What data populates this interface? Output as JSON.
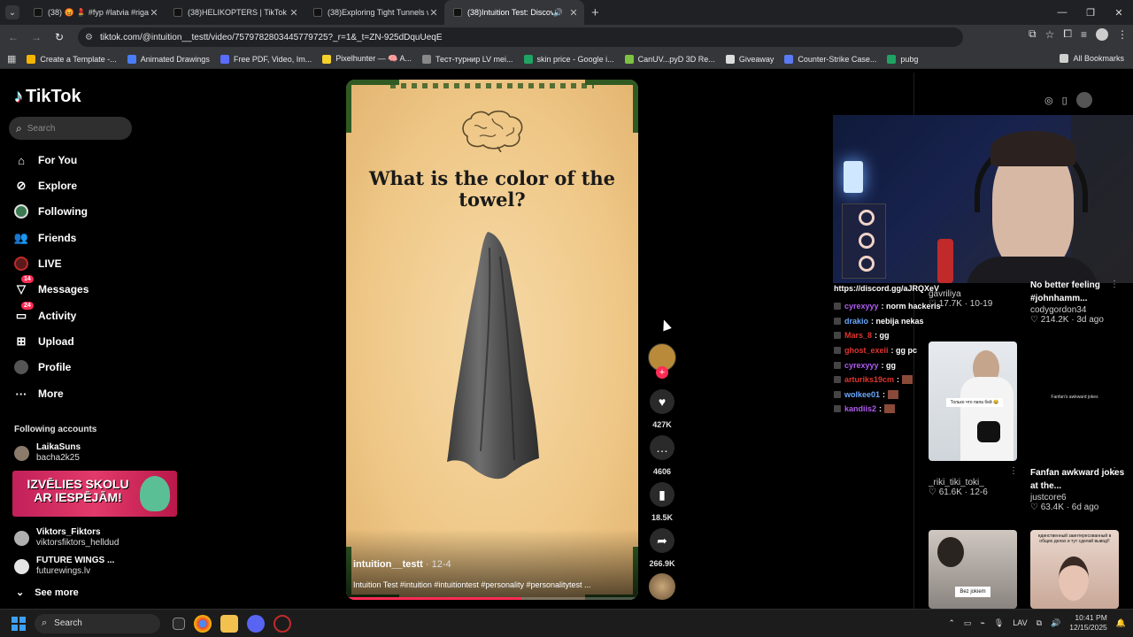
{
  "browser": {
    "tabs": [
      {
        "title": "(38) 😡 💄 #fyp #latvia #riga #i",
        "active": false
      },
      {
        "title": "(38)HELIKOPTERS | TikTok",
        "active": false
      },
      {
        "title": "(38)Exploring Tight Tunnels wit",
        "active": false
      },
      {
        "title": "(38)Intuition Test: Discover",
        "active": true
      }
    ],
    "url": "tiktok.com/@intuition__testt/video/7579782803445779725?_r=1&_t=ZN-925dDquUeqE",
    "bookmarks": [
      {
        "label": "Create a Template -...",
        "color": "#f4b400"
      },
      {
        "label": "Animated Drawings",
        "color": "#4a7df5"
      },
      {
        "label": "Free PDF, Video, Im...",
        "color": "#5a6cff"
      },
      {
        "label": "Pixelhunter — 🧠 A...",
        "color": "#f5d12b"
      },
      {
        "label": "Тест-турнир LV mei...",
        "color": "#888888"
      },
      {
        "label": "skin price - Google i...",
        "color": "#1fa463"
      },
      {
        "label": "CanUV...pyD 3D Re...",
        "color": "#7ec242"
      },
      {
        "label": "Giveaway",
        "color": "#dddddd"
      },
      {
        "label": "Counter-Strike Case...",
        "color": "#5a7bf5"
      },
      {
        "label": "pubg",
        "color": "#1fa463"
      }
    ],
    "all_bookmarks": "All Bookmarks"
  },
  "sidebar": {
    "logo": "TikTok",
    "search_placeholder": "Search",
    "nav": [
      {
        "label": "For You",
        "icon": "home-icon"
      },
      {
        "label": "Explore",
        "icon": "compass-icon"
      },
      {
        "label": "Following",
        "icon": "following-icon"
      },
      {
        "label": "Friends",
        "icon": "friends-icon"
      },
      {
        "label": "LIVE",
        "icon": "live-icon"
      },
      {
        "label": "Messages",
        "icon": "messages-icon",
        "badge": "14"
      },
      {
        "label": "Activity",
        "icon": "activity-icon",
        "badge": "24"
      },
      {
        "label": "Upload",
        "icon": "upload-icon"
      },
      {
        "label": "Profile",
        "icon": "profile-icon"
      },
      {
        "label": "More",
        "icon": "more-icon"
      }
    ],
    "following_title": "Following accounts",
    "following": [
      {
        "name": "LaikaSuns",
        "handle": "bacha2k25"
      },
      {
        "name": "Viktors_Fiktors",
        "handle": "viktorsfiktors_helldud"
      },
      {
        "name": "FUTURE WINGS ...",
        "handle": "futurewings.lv"
      }
    ],
    "ad_text": "IZVĒLIES SKOLU AR IESPĒJĀM!",
    "see_more": "See more"
  },
  "video": {
    "question": "What is the color of the towel?",
    "author": "intuition__testt",
    "date": "· 12-4",
    "caption": "Intuition Test #intuition #intuitiontest #personality #personalitytest ...",
    "progress": 0.6
  },
  "actions": {
    "likes": "427K",
    "comments": "4606",
    "saves": "18.5K",
    "shares": "266.9K"
  },
  "stream_chat": {
    "link": "https://discord.gg/aJRQXeV",
    "messages": [
      {
        "user": "cyrexyyy",
        "text": ": norm hackeris",
        "color": "#b05cf0"
      },
      {
        "user": "drakio",
        "text": ": nebija nekas",
        "color": "#6aa9ff"
      },
      {
        "user": "Mars_8",
        "text": ": gg",
        "color": "#e0352f"
      },
      {
        "user": "ghost_exeii",
        "text": ": gg pc",
        "color": "#e0352f"
      },
      {
        "user": "cyrexyyy",
        "text": ": gg",
        "color": "#b05cf0"
      },
      {
        "user": "arturiks19cm",
        "text": ":",
        "color": "#e0352f"
      },
      {
        "user": "wolkee01",
        "text": ":",
        "color": "#6aa9ff"
      },
      {
        "user": "kandiis2",
        "text": ":",
        "color": "#b05cf0"
      }
    ]
  },
  "related": [
    {
      "title": "",
      "user": "gavriliya",
      "likes": "17.7K",
      "date": "10-19"
    },
    {
      "title": "No better feeling #johnhamm...",
      "user": "codygordon34",
      "likes": "214.2K",
      "date": "3d ago"
    },
    {
      "title": "",
      "user": "_riki_tiki_toki_",
      "likes": "61.6K",
      "date": "12-6",
      "thumb_text": "Только что папа бей 😂"
    },
    {
      "title": "Fanfan awkward jokes at the...",
      "user": "justcore6",
      "likes": "63.4K",
      "date": "6d ago",
      "thumb_text": "Fanfan's awkward jokes"
    },
    {
      "title": "",
      "user": "",
      "likes": "",
      "date": "",
      "thumb_text": "Bez jokiem"
    },
    {
      "title": "",
      "user": "",
      "likes": "",
      "date": "",
      "thumb_text": "единственный заинтересованный в общих делах и тут сделай вывод!!"
    }
  ],
  "taskbar": {
    "search_placeholder": "Search",
    "lang": "LAV",
    "time": "10:41 PM",
    "date": "12/15/2025"
  },
  "colors": {
    "accent": "#fe2c55",
    "tiktok_cyan": "#25f4ee"
  }
}
